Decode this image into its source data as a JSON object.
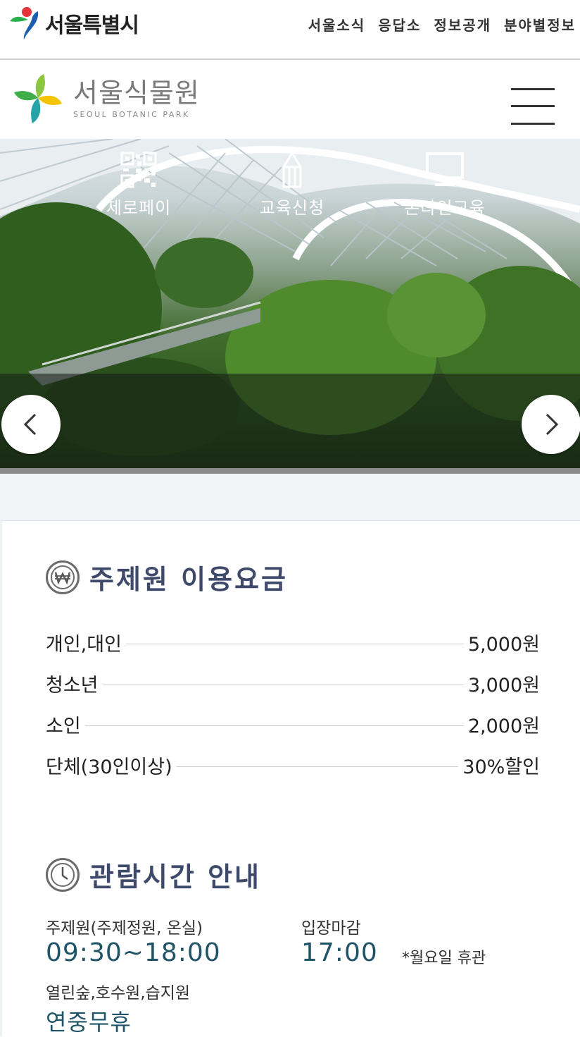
{
  "topbar": {
    "city_name": "서울특별시",
    "nav": [
      "서울소식",
      "응답소",
      "정보공개",
      "분야별정보"
    ]
  },
  "header": {
    "logo_ko": "서울식물원",
    "logo_en": "SEOUL BOTANIC PARK",
    "menu_icon": "hamburger-icon"
  },
  "hero": {
    "quick_links": [
      {
        "label": "제로페이",
        "icon": "qr-code-icon"
      },
      {
        "label": "교육신청",
        "icon": "pencil-icon"
      },
      {
        "label": "온라인교육",
        "icon": "monitor-icon"
      }
    ]
  },
  "fees": {
    "title": "주제원 이용요금",
    "icon": "won-icon",
    "rows": [
      {
        "label": "개인,대인",
        "value": "5,000원"
      },
      {
        "label": "청소년",
        "value": "3,000원"
      },
      {
        "label": "소인",
        "value": "2,000원"
      },
      {
        "label": "단체(30인이상)",
        "value": "30%할인"
      }
    ]
  },
  "hours": {
    "title": "관람시간 안내",
    "icon": "clock-icon",
    "main_label": "주제원(주제정원, 온실)",
    "main_value": "09:30~18:00",
    "close_label": "입장마감",
    "close_value": "17:00",
    "note": "*월요일 휴관",
    "outdoor_label": "열린숲,호수원,습지원",
    "outdoor_value": "연중무휴"
  },
  "colors": {
    "title": "#3f4a6b",
    "hours_value": "#1f5368"
  }
}
